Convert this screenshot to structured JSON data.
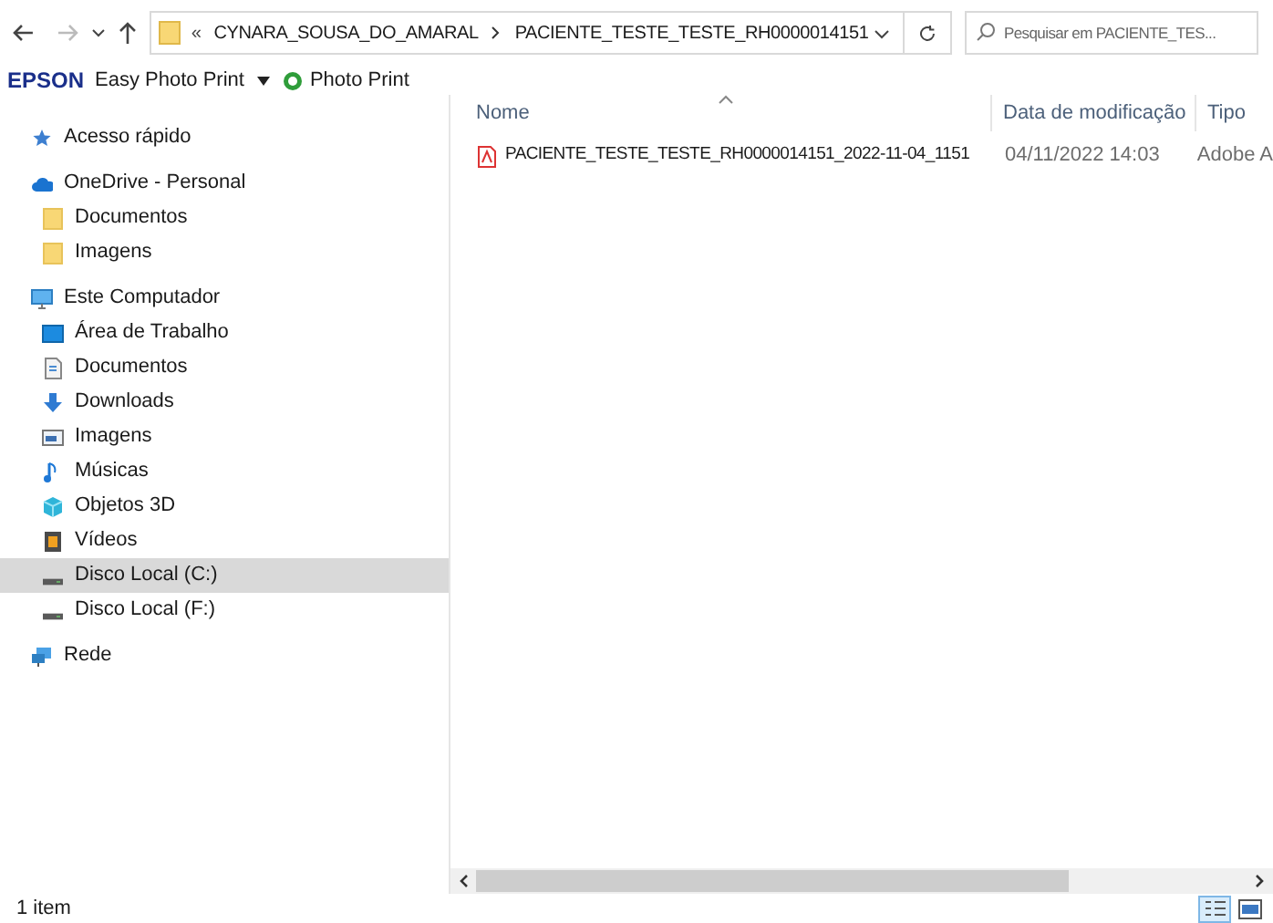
{
  "address_bar": {
    "overflow": "«",
    "crumbs": [
      "CYNARA_SOUSA_DO_AMARAL",
      "PACIENTE_TESTE_TESTE_RH0000014151"
    ]
  },
  "search": {
    "placeholder": "Pesquisar em PACIENTE_TES..."
  },
  "toolbar": {
    "brand": "EPSON",
    "items": [
      "Easy Photo Print",
      "Photo Print"
    ]
  },
  "sidebar": {
    "items": [
      {
        "label": "Acesso rápido",
        "kind": "star",
        "selected": false
      },
      {
        "label": "OneDrive - Personal",
        "kind": "cloud",
        "selected": false,
        "children": [
          {
            "label": "Documentos",
            "kind": "folder",
            "selected": false
          },
          {
            "label": "Imagens",
            "kind": "folder",
            "selected": false
          }
        ]
      },
      {
        "label": "Este Computador",
        "kind": "computer",
        "selected": false,
        "children": [
          {
            "label": "Área de Trabalho",
            "kind": "desktop",
            "selected": false
          },
          {
            "label": "Documentos",
            "kind": "document",
            "selected": false
          },
          {
            "label": "Downloads",
            "kind": "download",
            "selected": false
          },
          {
            "label": "Imagens",
            "kind": "image",
            "selected": false
          },
          {
            "label": "Músicas",
            "kind": "music",
            "selected": false
          },
          {
            "label": "Objetos 3D",
            "kind": "cube",
            "selected": false
          },
          {
            "label": "Vídeos",
            "kind": "video",
            "selected": false
          },
          {
            "label": "Disco Local (C:)",
            "kind": "drive",
            "selected": true
          },
          {
            "label": "Disco Local (F:)",
            "kind": "drive",
            "selected": false
          }
        ]
      },
      {
        "label": "Rede",
        "kind": "network",
        "selected": false
      }
    ]
  },
  "file_list": {
    "columns": [
      "Nome",
      "Data de modificação",
      "Tipo"
    ],
    "rows": [
      {
        "name": "PACIENTE_TESTE_TESTE_RH0000014151_2022-11-04_1151",
        "modified": "04/11/2022 14:03",
        "type": "Adobe A"
      }
    ]
  },
  "status_bar": {
    "count": "1 item"
  }
}
